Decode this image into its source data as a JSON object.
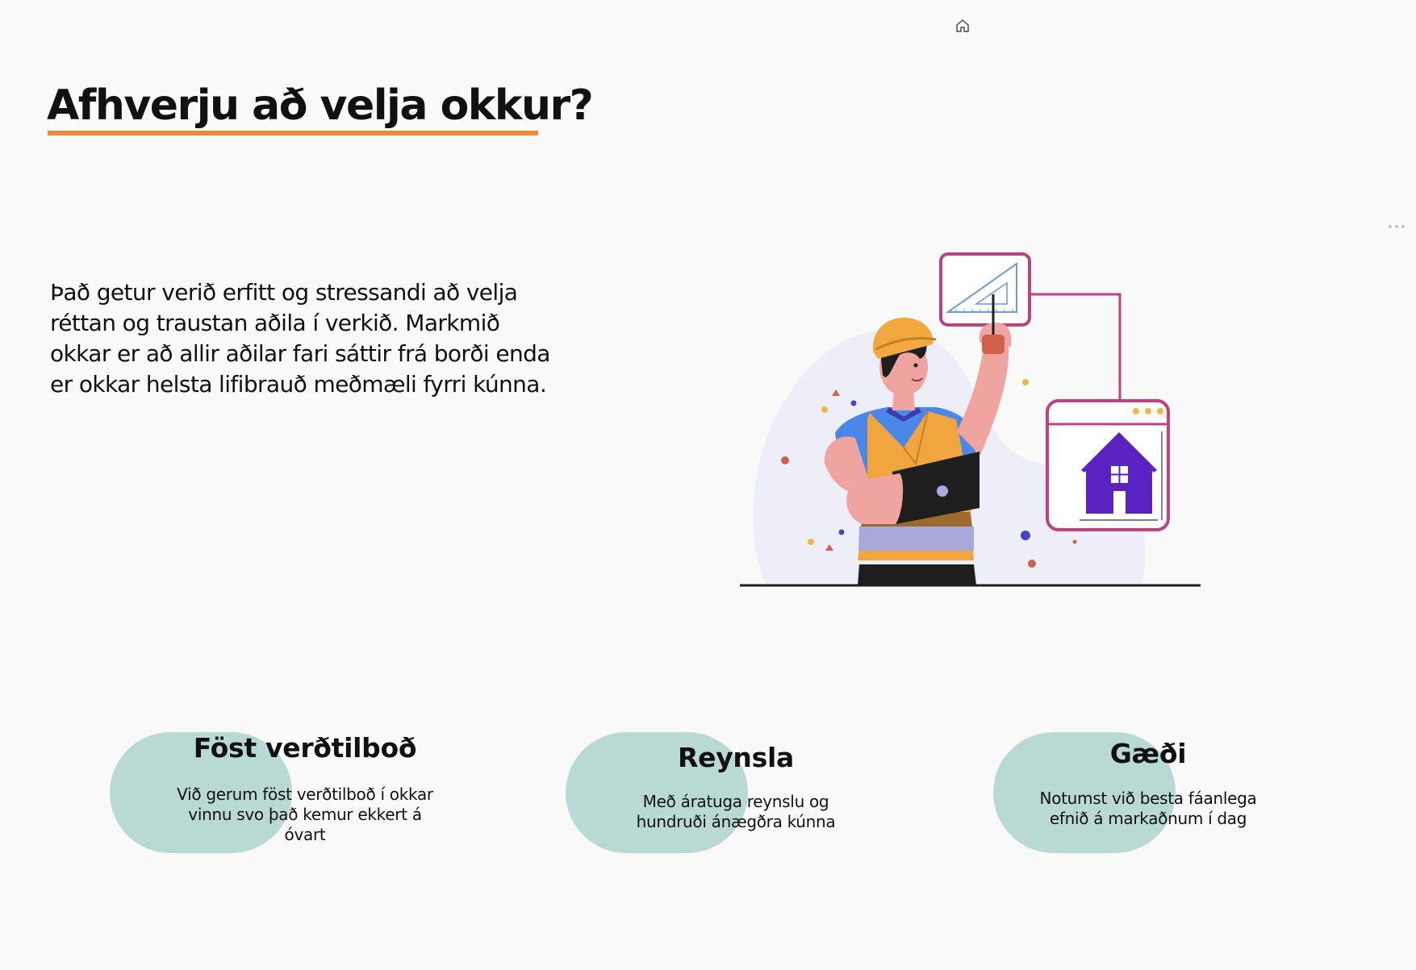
{
  "header": {
    "home_icon": "home-icon",
    "more_icon": "more-horizontal-icon"
  },
  "title": "Afhverju að velja okkur?",
  "intro": "Það getur verið erfitt og stressandi að velja réttan og traustan aðila í verkið. Markmið okkar er að allir aðilar fari sáttir frá borði enda er okkar helsta lifibrauð meðmæli fyrri kúnna.",
  "illustration": {
    "name": "construction-worker-illustration",
    "colors": {
      "accent_orange": "#ee8a3c",
      "frame_magenta": "#c0417f",
      "house_purple": "#5b22c2",
      "blob_lavender": "#eeeef9",
      "triangle_blue": "#6b9bd8"
    }
  },
  "features": [
    {
      "title": "Föst verðtilboð",
      "description": "Við gerum föst verðtilboð í okkar vinnu svo það kemur ekkert á óvart"
    },
    {
      "title": "Reynsla",
      "description": "Með áratuga reynslu og hundruði ánægðra kúnna"
    },
    {
      "title": "Gæði",
      "description": "Notumst við besta fáanlega efnið á markaðnum í dag"
    }
  ],
  "colors": {
    "background": "#f9f9f9",
    "underline": "#ee8a3c",
    "feature_blob": "#b9d9d5"
  }
}
